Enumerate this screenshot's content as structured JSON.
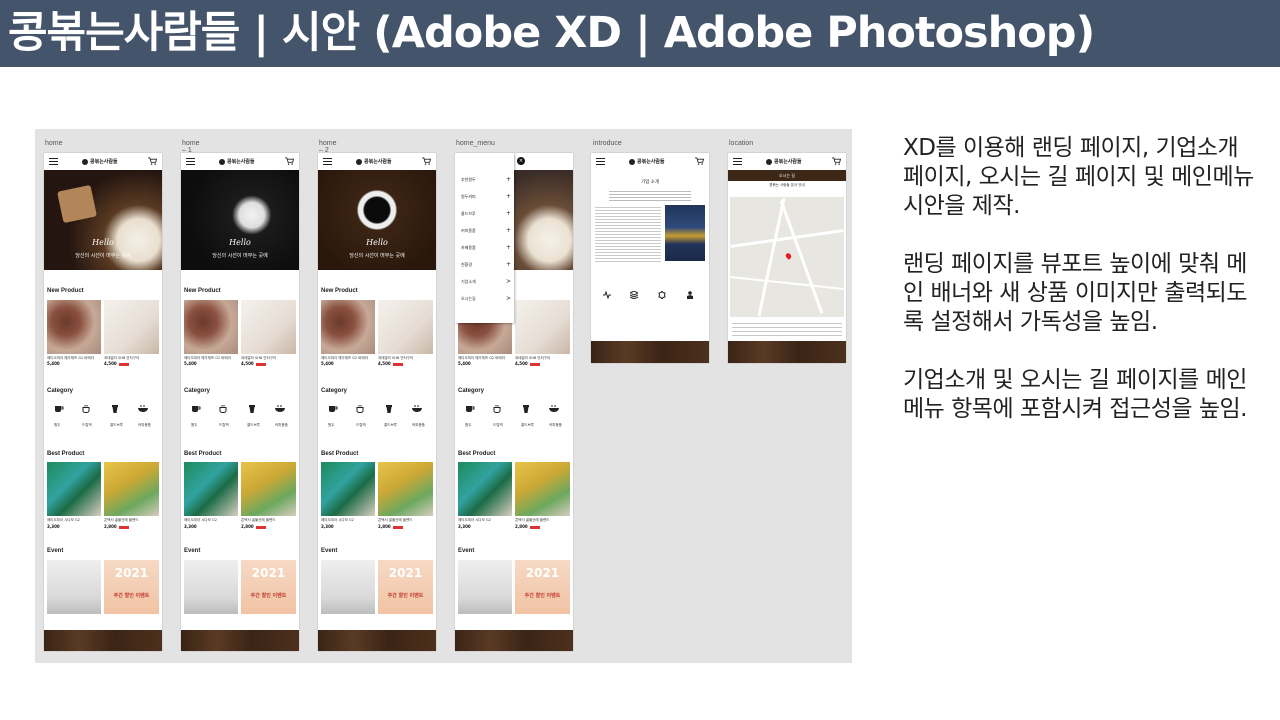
{
  "slide": {
    "title": "콩볶는사람들 | 시안 (Adobe XD | Adobe Photoshop)"
  },
  "artboards": [
    {
      "label": "home"
    },
    {
      "label": "home – 1"
    },
    {
      "label": "home – 2"
    },
    {
      "label": "home_menu"
    },
    {
      "label": "introduce"
    },
    {
      "label": "location"
    }
  ],
  "mockup": {
    "logo": "콩볶는사람들",
    "banner_script": "Hello",
    "banner_text": "당신의 시선이 머무는 곳에",
    "sections": {
      "new_product": "New Product",
      "category": "Category",
      "best_product": "Best Product",
      "event": "Event"
    },
    "new_products": [
      {
        "name": "에티오피아 예가체프 G2 바메라",
        "price": "5,400"
      },
      {
        "name": "과테말라 SHB 안티구아",
        "price": "4,500"
      }
    ],
    "categories": [
      "원두",
      "드립백",
      "콜드브루",
      "커피용품"
    ],
    "best_products": [
      {
        "name": "에티오피아 시다모 G2",
        "price": "3,300"
      },
      {
        "name": "콘택서 골불산래 블렌드",
        "price": "2,800"
      }
    ],
    "event_year": "2021",
    "event_title": "주간 할인 이벤트",
    "menu_items": [
      {
        "label": "추천원두",
        "indicator": "+"
      },
      {
        "label": "원두커피",
        "indicator": "+"
      },
      {
        "label": "콜드브루",
        "indicator": "+"
      },
      {
        "label": "커피용품",
        "indicator": "+"
      },
      {
        "label": "카페용품",
        "indicator": "+"
      },
      {
        "label": "친환경",
        "indicator": "+"
      },
      {
        "label": "기업소개",
        "indicator": ">"
      },
      {
        "label": "오시는길",
        "indicator": ">"
      }
    ],
    "menu_close": "×",
    "intro_title": "기업 소개",
    "location_title": "오시는 길",
    "location_sub": "콩볶는 사람들 본사 안내"
  },
  "notes": [
    "XD를 이용해 랜딩 페이지, 기업소개 페이지, 오시는 길 페이지 및 메인메뉴 시안을 제작.",
    "랜딩 페이지를 뷰포트 높이에 맞춰 메인 배너와 새 상품 이미지만 출력되도록 설정해서 가독성을 높임.",
    "기업소개 및 오시는 길 페이지를 메인메뉴 항목에 포함시켜 접근성을 높임."
  ]
}
